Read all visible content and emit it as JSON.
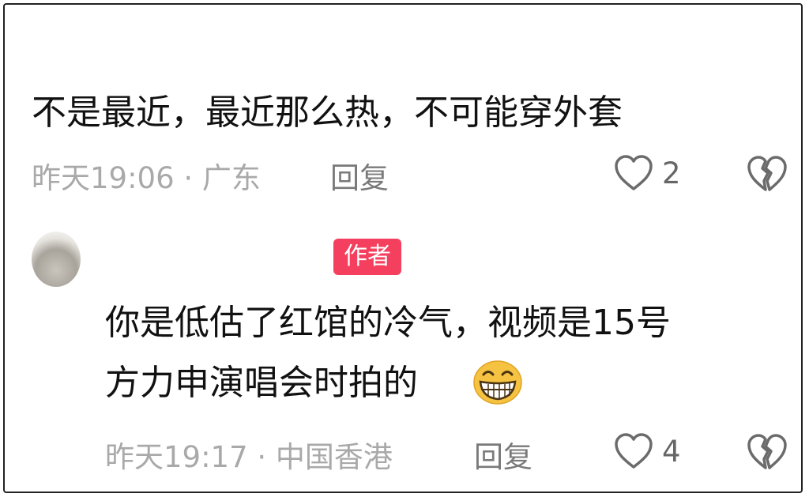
{
  "comments": [
    {
      "text": "不是最近，最近那么热，不可能穿外套",
      "meta": "昨天19:06 · 广东",
      "reply_label": "回复",
      "like_count": "2"
    },
    {
      "badge": "作者",
      "text_line1": "你是低估了红馆的冷气，视频是15号",
      "text_line2": "方力申演唱会时拍的",
      "emoji": "😁",
      "meta": "昨天19:17 · 中国香港",
      "reply_label": "回复",
      "like_count": "4"
    }
  ],
  "icons": {
    "like": "heart-outline-icon",
    "dislike": "broken-heart-icon",
    "emoji": "grinning-face-icon"
  },
  "colors": {
    "badge_bg": "#f43f5e",
    "meta_text": "#a9a9a9"
  }
}
